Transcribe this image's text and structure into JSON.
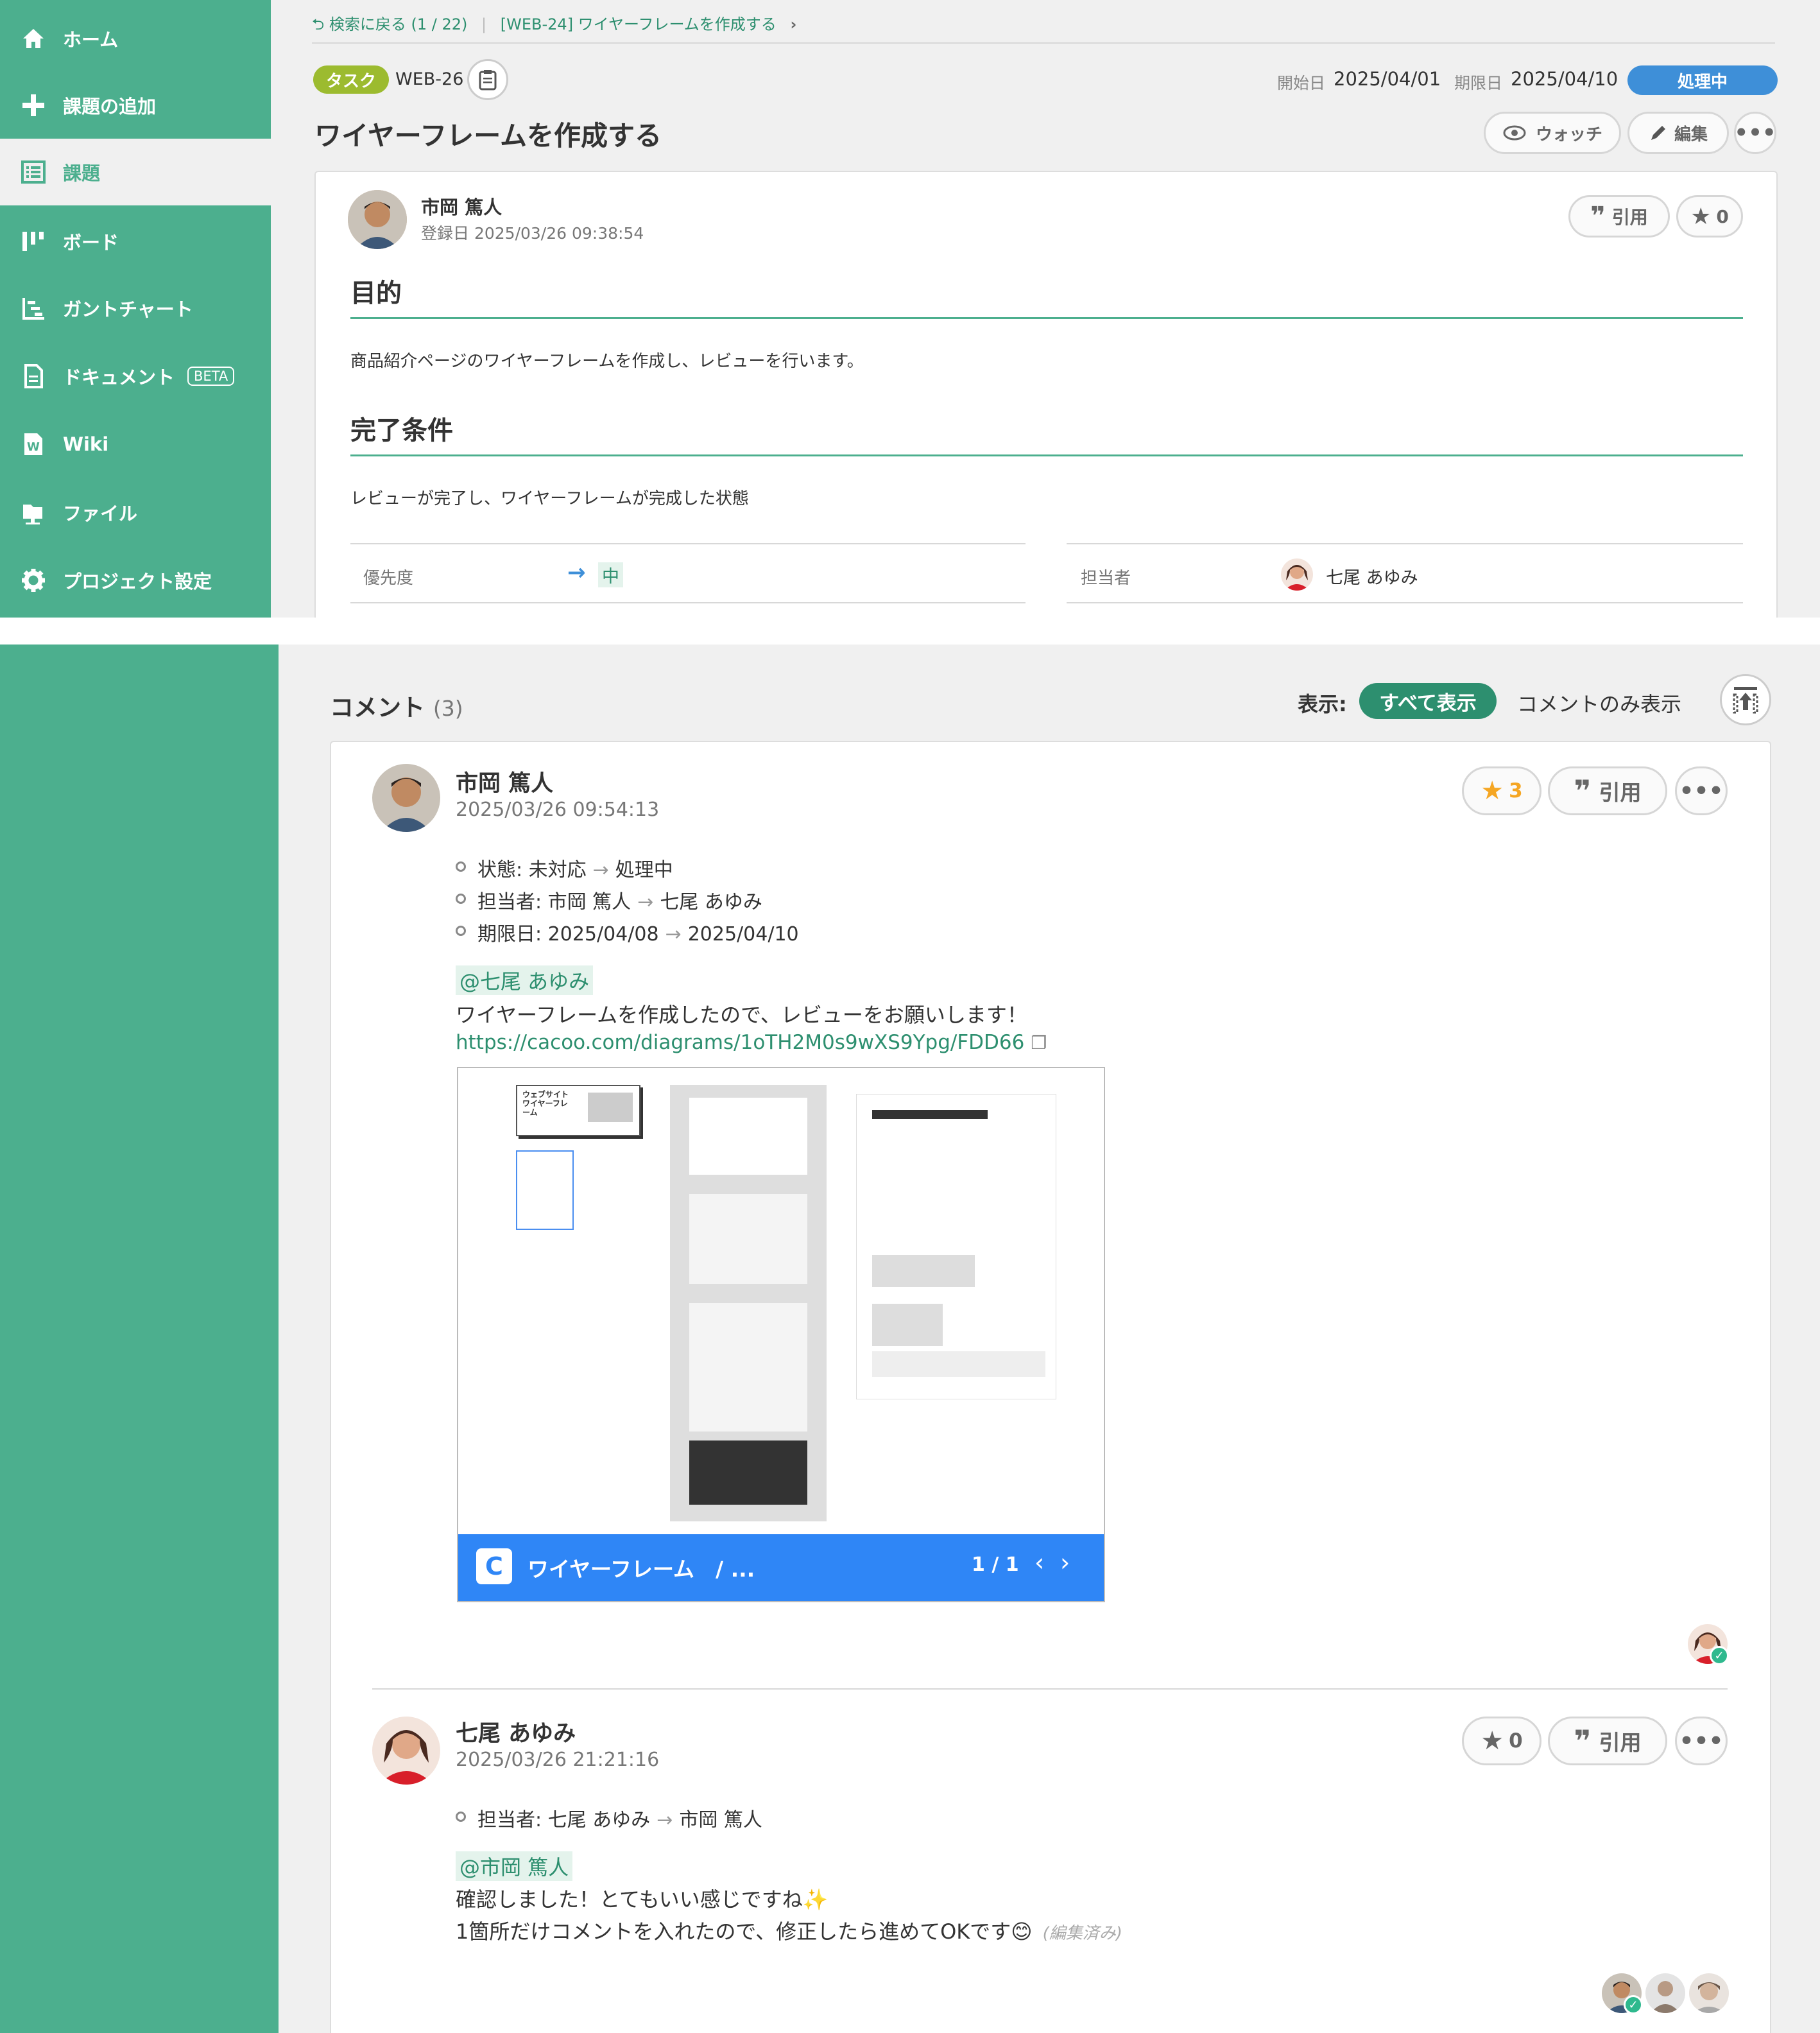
{
  "sidebar": {
    "items": [
      {
        "label": "ホーム",
        "icon": "home-icon"
      },
      {
        "label": "課題の追加",
        "icon": "plus-icon"
      },
      {
        "label": "課題",
        "icon": "list-icon"
      },
      {
        "label": "ボード",
        "icon": "board-icon"
      },
      {
        "label": "ガントチャート",
        "icon": "gantt-icon"
      },
      {
        "label": "ドキュメント",
        "icon": "document-icon",
        "badge": "BETA"
      },
      {
        "label": "Wiki",
        "icon": "wiki-icon"
      },
      {
        "label": "ファイル",
        "icon": "folder-icon"
      },
      {
        "label": "プロジェクト設定",
        "icon": "gear-icon"
      }
    ]
  },
  "breadcrumb": {
    "back": "検索に戻る (1 / 22)",
    "separator": "|",
    "parent": "[WEB-24] ワイヤーフレームを作成する"
  },
  "issue": {
    "type": "タスク",
    "key": "WEB-26",
    "start_label": "開始日",
    "start_date": "2025/04/01",
    "due_label": "期限日",
    "due_date": "2025/04/10",
    "status": "処理中",
    "title": "ワイヤーフレームを作成する",
    "watch_label": "ウォッチ",
    "edit_label": "編集",
    "author": "市岡 篤人",
    "registered": "登録日  2025/03/26 09:38:54",
    "quote_label": "引用",
    "star_count": "0",
    "purpose_heading": "目的",
    "purpose_text": "商品紹介ページのワイヤーフレームを作成し、レビューを行います。",
    "done_heading": "完了条件",
    "done_text": "レビューが完了し、ワイヤーフレームが完成した状態",
    "priority_label": "優先度",
    "priority_value": "中",
    "assignee_label": "担当者",
    "assignee_value": "七尾 あゆみ"
  },
  "comments_header": {
    "title": "コメント",
    "count": "(3)",
    "display_label": "表示:",
    "filter_all": "すべて表示",
    "filter_comments": "コメントのみ表示"
  },
  "comments": [
    {
      "author": "市岡 篤人",
      "date": "2025/03/26 09:54:13",
      "star_count": "3",
      "quote_label": "引用",
      "changes": [
        {
          "field": "状態: 未対応",
          "to": "処理中"
        },
        {
          "field": "担当者: 市岡 篤人",
          "to": "七尾 あゆみ"
        },
        {
          "field": "期限日: 2025/04/08",
          "to": "2025/04/10"
        }
      ],
      "mention": "@七尾 あゆみ",
      "body": "ワイヤーフレームを作成したので、レビューをお願いします！",
      "link": "https://cacoo.com/diagrams/1oTH2M0s9wXS9Ypg/FDD66",
      "embed": {
        "title": "ワイヤーフレーム　/ ...",
        "page": "1 / 1",
        "thumb_label": "ウェブサイト ワイヤーフレーム"
      }
    },
    {
      "author": "七尾 あゆみ",
      "date": "2025/03/26 21:21:16",
      "star_count": "0",
      "quote_label": "引用",
      "changes": [
        {
          "field": "担当者: 七尾 あゆみ",
          "to": "市岡 篤人"
        }
      ],
      "mention": "@市岡 篤人",
      "body_line1": "確認しました！とてもいい感じですね✨",
      "body_line2": "1箇所だけコメントを入れたので、修正したら進めてOKです😊",
      "edited": "(編集済み)"
    }
  ],
  "colors": {
    "sidebar": "#4caf8e",
    "accent_green": "#2d8f6f",
    "status_blue": "#3e8fd8",
    "task_badge": "#9cbb2f",
    "embed_bar": "#2f86f6",
    "star_gold": "#f5a623"
  }
}
